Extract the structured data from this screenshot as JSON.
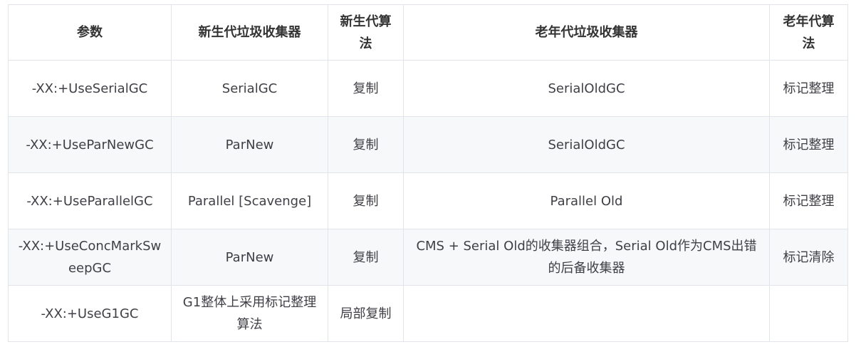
{
  "table": {
    "headers": [
      "参数",
      "新生代垃圾收集器",
      "新生代算法",
      "老年代垃圾收集器",
      "老年代算法"
    ],
    "rows": [
      [
        "-XX:+UseSerialGC",
        "SerialGC",
        "复制",
        "SerialOldGC",
        "标记整理"
      ],
      [
        "-XX:+UseParNewGC",
        "ParNew",
        "复制",
        "SerialOldGC",
        "标记整理"
      ],
      [
        "-XX:+UseParallelGC",
        "Parallel [Scavenge]",
        "复制",
        "Parallel Old",
        "标记整理"
      ],
      [
        "-XX:+UseConcMarkSweepGC",
        "ParNew",
        "复制",
        "CMS + Serial Old的收集器组合，Serial Old作为CMS出错的后备收集器",
        "标记清除"
      ],
      [
        "-XX:+UseG1GC",
        "G1整体上采用标记整理算法",
        "局部复制",
        "",
        ""
      ]
    ]
  }
}
